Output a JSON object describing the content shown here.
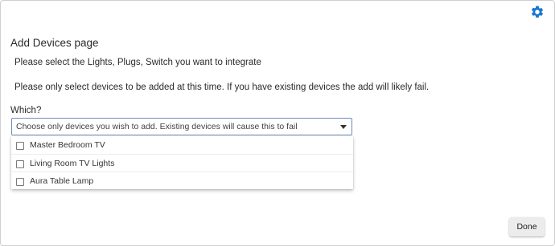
{
  "header": {
    "settings_icon": "gear-icon",
    "accent_color": "#1976d2"
  },
  "page": {
    "title": "Add Devices page",
    "instruction": "Please select the Lights, Plugs, Switch you want to integrate",
    "warning": "Please only select devices to be added at this time. If you have existing devices the add will likely fail."
  },
  "device_select": {
    "label": "Which?",
    "placeholder": "Choose only devices you wish to add. Existing devices will cause this to fail",
    "options": [
      {
        "label": "Master Bedroom TV",
        "checked": false
      },
      {
        "label": "Living Room TV Lights",
        "checked": false
      },
      {
        "label": "Aura Table Lamp",
        "checked": false
      }
    ]
  },
  "footer": {
    "done_label": "Done"
  }
}
